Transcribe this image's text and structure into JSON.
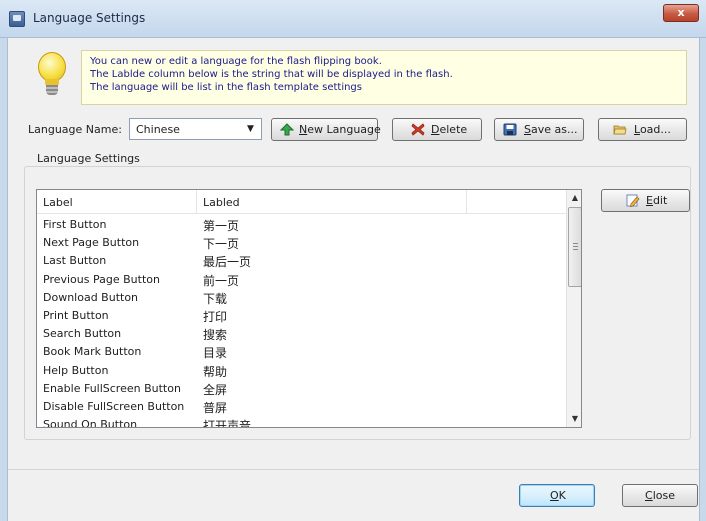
{
  "window": {
    "title": "Language Settings",
    "close_glyph": "x"
  },
  "info": {
    "lines": [
      "You can new or edit  a language for the flash flipping book.",
      "The Lablde column below is the string that will be displayed in the flash.",
      "The language will be list in the flash template settings"
    ],
    "icon": "lightbulb-icon"
  },
  "toolbar": {
    "language_name_label": "Language Name:",
    "language_selected": "Chinese",
    "new_language": {
      "u": "N",
      "rest": "ew Language",
      "icon": "green-arrow-up-icon"
    },
    "delete": {
      "u": "D",
      "rest": "elete",
      "icon": "red-x-icon"
    },
    "save_as": {
      "u": "S",
      "rest": "ave as...",
      "icon": "floppy-disk-icon"
    },
    "load": {
      "u": "L",
      "rest": "oad...",
      "icon": "open-folder-icon"
    }
  },
  "group": {
    "title": "Language Settings"
  },
  "table": {
    "columns": [
      "Label",
      "Labled",
      ""
    ],
    "rows": [
      {
        "label": "First Button",
        "labled": "第一页"
      },
      {
        "label": "Next Page Button",
        "labled": "下一页"
      },
      {
        "label": "Last Button",
        "labled": "最后一页"
      },
      {
        "label": "Previous Page Button",
        "labled": "前一页"
      },
      {
        "label": "Download Button",
        "labled": "下载"
      },
      {
        "label": "Print Button",
        "labled": "打印"
      },
      {
        "label": "Search Button",
        "labled": "搜索"
      },
      {
        "label": "Book Mark Button",
        "labled": "目录"
      },
      {
        "label": "Help Button",
        "labled": "帮助"
      },
      {
        "label": "Enable FullScreen Button",
        "labled": "全屏"
      },
      {
        "label": "Disable FullScreen Button",
        "labled": "普屏"
      },
      {
        "label": "Sound On Button",
        "labled": "打开声音"
      }
    ]
  },
  "edit_button": {
    "u": "E",
    "rest": "dit",
    "icon": "edit-pencil-icon"
  },
  "footer": {
    "ok": {
      "u": "O",
      "rest": "K"
    },
    "close": {
      "u": "C",
      "rest": "lose"
    }
  },
  "colors": {
    "info_bg": "#ffffe4",
    "info_text": "#1a1a8c",
    "titlebar": "#c4d7ec",
    "close_red": "#c75a43"
  }
}
